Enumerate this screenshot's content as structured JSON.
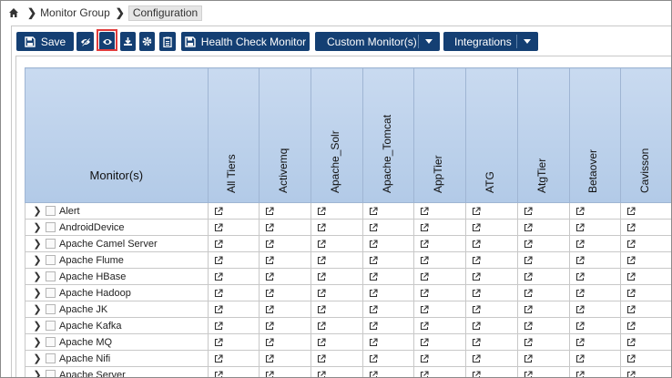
{
  "breadcrumb": {
    "items": [
      "Monitor Group",
      "Configuration"
    ]
  },
  "toolbar": {
    "save_label": "Save",
    "health_check_label": "Health Check Monitor",
    "custom_monitors_label": "Custom Monitor(s)",
    "integrations_label": "Integrations"
  },
  "grid": {
    "monitor_header": "Monitor(s)",
    "columns": [
      "All Tiers",
      "Activemq",
      "Apache_Solr",
      "Apache_Tomcat",
      "AppTier",
      "ATG",
      "AtgTier",
      "Betaover",
      "Cavisson"
    ],
    "rows": [
      "Alert",
      "AndroidDevice",
      "Apache Camel Server",
      "Apache Flume",
      "Apache HBase",
      "Apache Hadoop",
      "Apache JK",
      "Apache Kafka",
      "Apache MQ",
      "Apache Nifi",
      "Apache Server"
    ]
  },
  "colors": {
    "button_bg": "#143f73",
    "header_bg": "#b2cae7",
    "highlight": "#e23c3c"
  }
}
